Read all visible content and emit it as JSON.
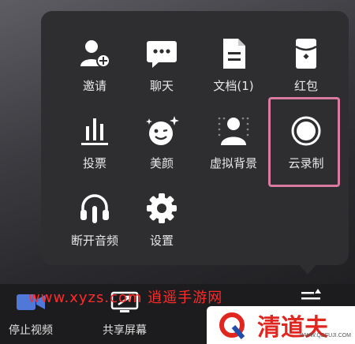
{
  "menu": {
    "items": [
      {
        "label": "邀请",
        "icon": "add-user-icon"
      },
      {
        "label": "聊天",
        "icon": "chat-icon"
      },
      {
        "label": "文档(1)",
        "icon": "document-icon"
      },
      {
        "label": "红包",
        "icon": "red-envelope-icon"
      },
      {
        "label": "投票",
        "icon": "vote-icon"
      },
      {
        "label": "美颜",
        "icon": "beauty-icon"
      },
      {
        "label": "虚拟背景",
        "icon": "virtual-background-icon"
      },
      {
        "label": "云录制",
        "icon": "record-icon"
      },
      {
        "label": "断开音频",
        "icon": "headphones-icon"
      },
      {
        "label": "设置",
        "icon": "gear-icon"
      }
    ]
  },
  "toolbar": {
    "stop_video_label": "停止视频",
    "share_screen_label": "共享屏幕"
  },
  "watermark": {
    "text": "www.xyzs.com 逍遥手游网"
  },
  "brand": {
    "name": "清道夫",
    "url": "WWW.QDFUJI.COM"
  },
  "colors": {
    "highlight": "#d97aa0",
    "watermark": "#ff2a2a",
    "brand": "#e0261f"
  }
}
